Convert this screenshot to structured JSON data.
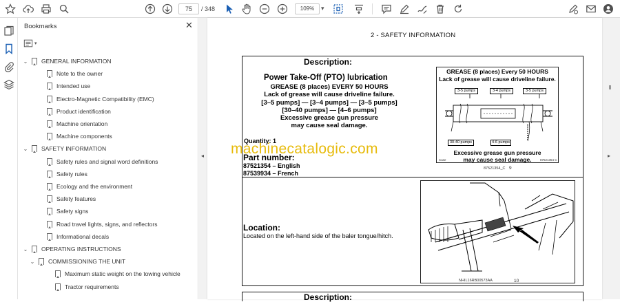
{
  "toolbar": {
    "page_current": "75",
    "page_total": "/ 348",
    "zoom": "109%"
  },
  "panel": {
    "title": "Bookmarks",
    "close_glyph": "✕"
  },
  "bookmarks": [
    {
      "label": "GENERAL INFORMATION",
      "level": 0,
      "expanded": true
    },
    {
      "label": "Note to the owner",
      "level": 1
    },
    {
      "label": "Intended use",
      "level": 1
    },
    {
      "label": "Electro-Magnetic Compatibility (EMC)",
      "level": 1
    },
    {
      "label": "Product identification",
      "level": 1
    },
    {
      "label": "Machine orientation",
      "level": 1
    },
    {
      "label": "Machine components",
      "level": 1
    },
    {
      "label": "SAFETY INFORMATION",
      "level": 0,
      "expanded": true
    },
    {
      "label": "Safety rules and signal word definitions",
      "level": 1
    },
    {
      "label": "Safety rules",
      "level": 1
    },
    {
      "label": "Ecology and the environment",
      "level": 1
    },
    {
      "label": "Safety features",
      "level": 1
    },
    {
      "label": "Safety signs",
      "level": 1
    },
    {
      "label": "Road travel lights, signs, and reflectors",
      "level": 1
    },
    {
      "label": "Informational decals",
      "level": 1
    },
    {
      "label": "OPERATING INSTRUCTIONS",
      "level": 0,
      "expanded": true
    },
    {
      "label": "COMMISSIONING THE UNIT",
      "level": 1,
      "expanded": true
    },
    {
      "label": "Maximum static weight on the towing vehicle",
      "level": 2
    },
    {
      "label": "Tractor requirements",
      "level": 2
    }
  ],
  "document": {
    "section_title": "2 - SAFETY INFORMATION",
    "description_heading": "Description:",
    "description_title": "Power Take-Off (PTO) lubrication",
    "description_lines": [
      "GREASE (8 places) EVERY 50 HOURS",
      "Lack of grease will cause driveline failure.",
      "[3–5 pumps] — [3–4 pumps] — [3–5 pumps]",
      "[30–40 pumps] — [4–6 pumps]",
      "Excessive grease gun pressure",
      "may cause seal damage."
    ],
    "quantity": "Quantity:  1",
    "part_heading": "Part number:",
    "part_english": "87521354 – English",
    "part_french": "87539934 – French",
    "decal": {
      "title_line1": "GREASE (8 places) Every 50 HOURS",
      "title_line2": "Lack of grease will cause driveline failure.",
      "pump_a": "3-5 pumps",
      "pump_b": "3-4 pumps",
      "pump_c": "3-5 pumps",
      "pump_d": "30-40 pumps",
      "pump_e": "4-6 pumps",
      "bottom_line1": "Excessive grease gun pressure",
      "bottom_line2": "may cause seal damage.",
      "code_left": "Case",
      "code_right": "87521354 C",
      "caption": "87521354_C",
      "number": "9"
    },
    "location_heading": "Location:",
    "location_text": "Located on the left-hand side of the baler tongue/hitch.",
    "photo_caption": "NHIL16RB00573AA",
    "photo_number": "10",
    "description_heading_next": "Description:"
  },
  "watermark": "machinecatalogic.com",
  "colors": {
    "watermark": "#e6b800",
    "accent": "#1a5fb4"
  }
}
